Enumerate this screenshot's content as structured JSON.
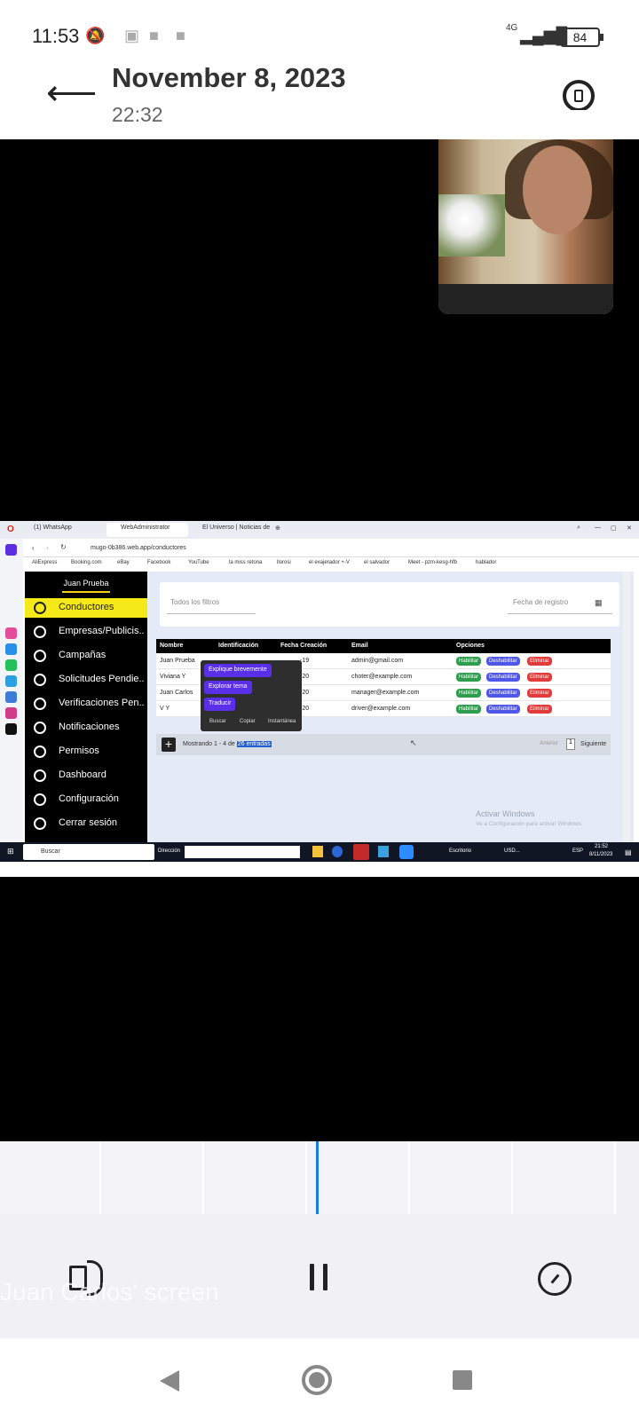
{
  "status_bar": {
    "time": "11:53",
    "network": "4G",
    "battery": "84",
    "icons": [
      "silent-icon",
      "screen-record-icon",
      "video-icon",
      "signal-icon"
    ]
  },
  "header": {
    "date": "November 8, 2023",
    "time": "22:32"
  },
  "browser": {
    "tabs": [
      "(1) WhatsApp",
      "WebAdministrator",
      "El Universo | Noticias de"
    ],
    "url": "mugo-0b386.web.app/conductores",
    "bookmarks": [
      "AliExpress",
      "Booking.com",
      "eBay",
      "Facebook",
      "YouTube",
      "la miss retona",
      "llorosi",
      "el exajerador +-V",
      "el salvador",
      "Meet - pzm-kesg-hfb",
      "hablador"
    ]
  },
  "app": {
    "user_name": "Juan Prueba",
    "nav": [
      {
        "label": "Conductores",
        "icon": "user-circle-icon",
        "active": true
      },
      {
        "label": "Empresas/Publicis..",
        "icon": "building-icon",
        "active": false
      },
      {
        "label": "Campañas",
        "icon": "megaphone-icon",
        "active": false
      },
      {
        "label": "Solicitudes Pendie..",
        "icon": "list-icon",
        "active": false
      },
      {
        "label": "Verificaciones Pen..",
        "icon": "edit-icon",
        "active": false
      },
      {
        "label": "Notificaciones",
        "icon": "bell-icon",
        "active": false
      },
      {
        "label": "Permisos",
        "icon": "check-circle-icon",
        "active": false
      },
      {
        "label": "Dashboard",
        "icon": "gauge-icon",
        "active": false
      },
      {
        "label": "Configuración",
        "icon": "gear-icon",
        "active": false
      },
      {
        "label": "Cerrar sesión",
        "icon": "logout-icon",
        "active": false
      }
    ],
    "filter_placeholder": "Todos los filtros",
    "date_placeholder": "Fecha de registro",
    "table": {
      "headers": [
        "Nombre",
        "Identificación",
        "Fecha Creación",
        "Email",
        "Opciones"
      ],
      "rows": [
        {
          "name": "Juan Prueba",
          "created": "-19",
          "email": "admin@gmail.com"
        },
        {
          "name": "Viviana Y",
          "created": "-20",
          "email": "choter@example.com"
        },
        {
          "name": "Juan Carlos",
          "created": "-20",
          "email": "manager@example.com"
        },
        {
          "name": "V Y",
          "created": "-20",
          "email": "driver@example.com"
        }
      ],
      "actions": [
        "Habilitar",
        "Deshabilitar",
        "Eliminar"
      ]
    },
    "popup": {
      "items": [
        "Explique brevemente",
        "Explorar tema",
        "Traducir"
      ],
      "footer": [
        "Buscar",
        "Copiar",
        "Instantánea"
      ]
    },
    "pager": {
      "showing_prefix": "Mostrando 1 - 4 de",
      "showing_highlight": "26 entradas",
      "prev": "Anterior",
      "page": "1",
      "next": "Siguiente"
    },
    "watermark": [
      "Activar Windows",
      "Ve a Configuración para activar Windows."
    ]
  },
  "taskbar": {
    "search": "Buscar",
    "address_label": "Dirección",
    "desktop": "Escritorio",
    "currency": "USD...",
    "lang": "ESP",
    "time": "21:52",
    "date": "8/11/2023"
  },
  "player": {
    "caption": "Juan Carlos' screen"
  },
  "colors": {
    "active_nav": "#f5e91a",
    "habilitar": "#2e9d4d",
    "deshabilitar": "#4f57e8",
    "eliminar": "#e23b3b",
    "playhead": "#1e7be0"
  }
}
